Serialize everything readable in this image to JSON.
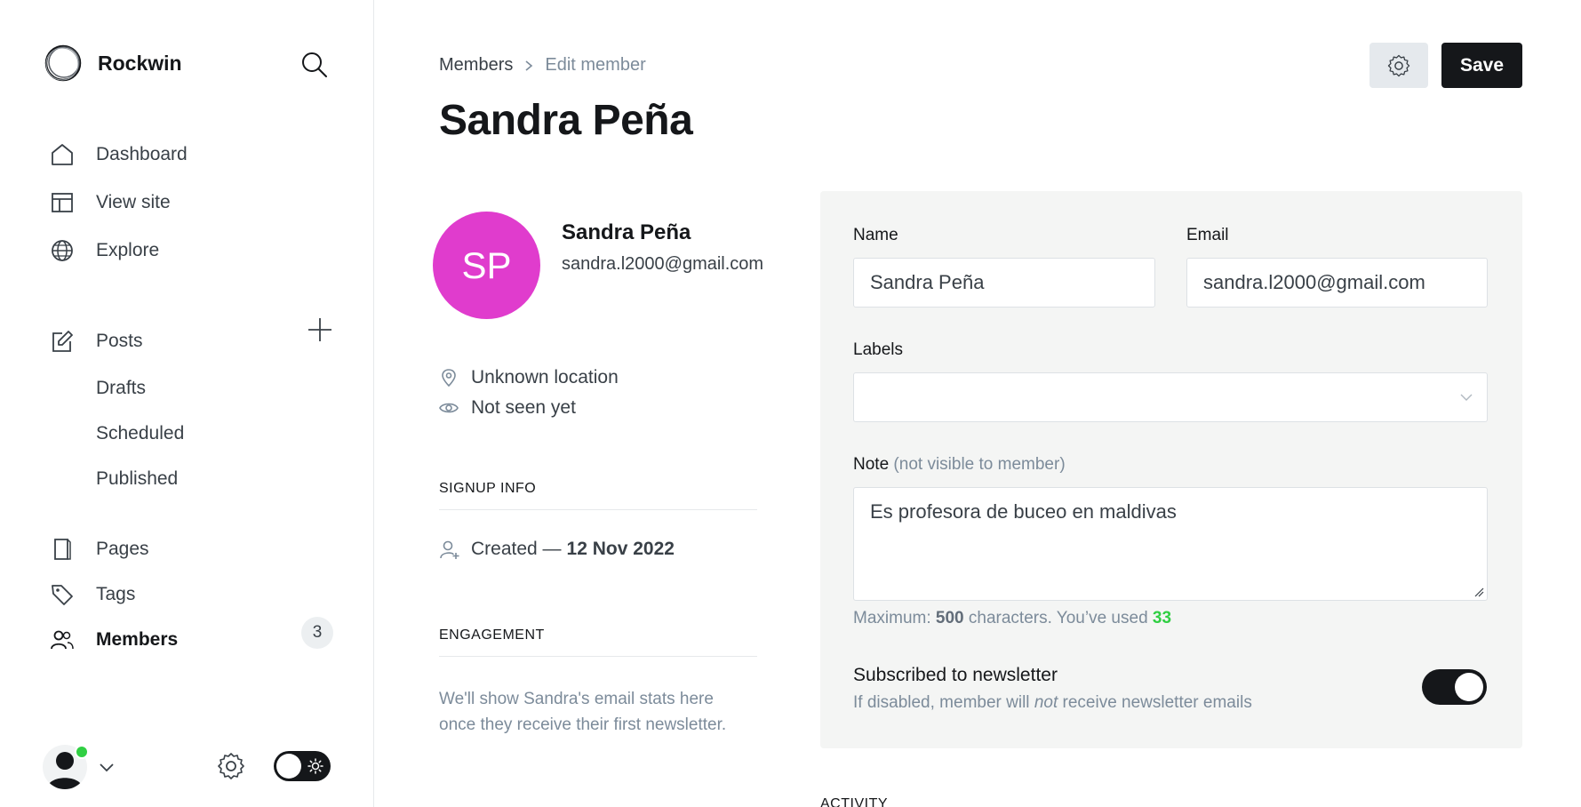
{
  "sidebar": {
    "brand": "Rockwin",
    "nav": [
      {
        "label": "Dashboard",
        "icon": "home-icon"
      },
      {
        "label": "View site",
        "icon": "layout-icon"
      },
      {
        "label": "Explore",
        "icon": "globe-icon"
      }
    ],
    "posts": {
      "label": "Posts",
      "sub": [
        "Drafts",
        "Scheduled",
        "Published"
      ]
    },
    "pages": "Pages",
    "tags": "Tags",
    "members": {
      "label": "Members",
      "count": "3"
    }
  },
  "header": {
    "breadcrumb_parent": "Members",
    "breadcrumb_current": "Edit member",
    "title": "Sandra Peña",
    "save_label": "Save"
  },
  "profile": {
    "initials": "SP",
    "avatar_color": "#e03ccd",
    "name": "Sandra Peña",
    "email": "sandra.l2000@gmail.com",
    "location": "Unknown location",
    "seen": "Not seen yet",
    "signup_heading": "SIGNUP INFO",
    "created_label": "Created —",
    "created_date": "12 Nov 2022",
    "engagement_heading": "ENGAGEMENT",
    "engagement_text": "We'll show Sandra's email stats here once they receive their first newsletter."
  },
  "form": {
    "name_label": "Name",
    "name_value": "Sandra Peña",
    "email_label": "Email",
    "email_value": "sandra.l2000@gmail.com",
    "labels_label": "Labels",
    "note_label": "Note",
    "note_hint": "(not visible to member)",
    "note_value": "Es profesora de buceo en maldivas",
    "char_prefix": "Maximum:",
    "char_max": "500",
    "char_mid": "characters. You’ve used",
    "char_used": "33",
    "newsletter_title": "Subscribed to newsletter",
    "newsletter_desc_pre": "If disabled, member will",
    "newsletter_desc_not": "not",
    "newsletter_desc_post": "receive newsletter emails",
    "newsletter_subscribed": true
  },
  "activity_heading": "ACTIVITY",
  "colors": {
    "accent_green": "#30cf43",
    "primary_dark": "#15171a"
  }
}
